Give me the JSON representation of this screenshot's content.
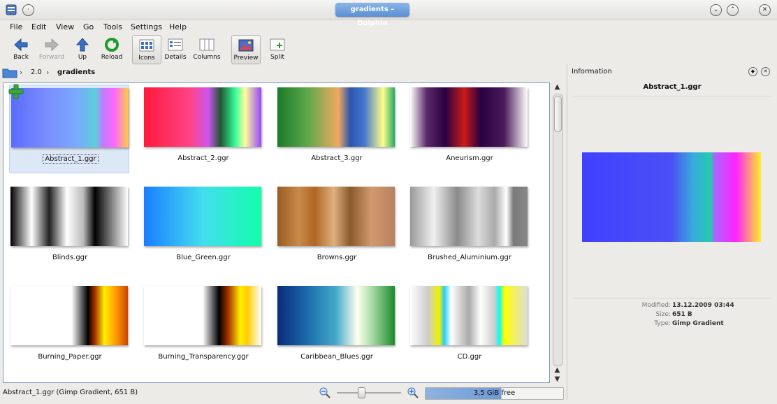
{
  "window": {
    "title": "gradients – Dolphin"
  },
  "menu": [
    "File",
    "Edit",
    "View",
    "Go",
    "Tools",
    "Settings",
    "Help"
  ],
  "toolbar": {
    "back": "Back",
    "forward": "Forward",
    "up": "Up",
    "reload": "Reload",
    "icons": "Icons",
    "details": "Details",
    "columns": "Columns",
    "preview": "Preview",
    "split": "Split"
  },
  "breadcrumb": {
    "parent": "2.0",
    "current": "gradients"
  },
  "files": [
    {
      "name": "Abstract_1.ggr",
      "gradient": "linear-gradient(90deg,#5a6cff 0%,#7a8cff 30%,#7aa8ff 55%,#5ccfd9 72%,#c07cff 78%,#ff66ff 88%,#ffd044 100%)"
    },
    {
      "name": "Abstract_2.ggr",
      "gradient": "linear-gradient(90deg,#ff1a3a 0%,#ff4488 40%,#cc55ee 55%,#225533 65%,#33ff99 78%,#ffff99 86%,#9944ff 100%)"
    },
    {
      "name": "Abstract_3.ggr",
      "gradient": "linear-gradient(90deg,#1d7a2a 0%,#5ba84a 25%,#f0a860 52%,#2a55b0 62%,#4477cc 74%,#ffff88 90%,#22aa66 100%)"
    },
    {
      "name": "Aneurism.ggr",
      "gradient": "linear-gradient(90deg,#ffffff 0%,#5a2a6a 14%,#2a0040 30%,#cc1a1a 46%,#2a0040 60%,#4a1a5a 80%,#ffffff 100%)"
    },
    {
      "name": "Blinds.ggr",
      "gradient": "linear-gradient(90deg,#000 0%,#fff 18%,#222 33%,#ffffff 48%,#bbb 62%,#000 72%,#ffffff 100%)"
    },
    {
      "name": "Blue_Green.ggr",
      "gradient": "linear-gradient(90deg,#1a7dff 0%,#44ddee 50%,#11ffaa 100%)"
    },
    {
      "name": "Browns.ggr",
      "gradient": "linear-gradient(90deg,#9a5a22 0%,#c88a4a 18%,#b06622 32%,#e0b080 48%,#8a5a2a 62%,#d09a70 80%,#b88060 100%)"
    },
    {
      "name": "Brushed_Aluminium.ggr",
      "gradient": "linear-gradient(90deg,#999 0%,#f0f0f0 20%,#8a8a8a 40%,#dcdcdc 58%,#aaa 72%,#ffffff 82%,#7a7a7a 88%,#888 100%)"
    },
    {
      "name": "Burning_Paper.ggr",
      "gradient": "linear-gradient(90deg,#ffffff 0%,#ffffff 52%,#000 66%,#aa3300 72%,#ffee00 80%,#ff9900 90%,#cc4400 100%)"
    },
    {
      "name": "Burning_Transparency.ggr",
      "gradient": "linear-gradient(90deg,#ffffff 0%,#ffffff 50%,#000 64%,#aa3300 72%,#ffee00 82%,#ffcc00 88%,#ffffff 100%)"
    },
    {
      "name": "Caribbean_Blues.ggr",
      "gradient": "linear-gradient(90deg,#0a2a7a 0%,#1a6aaa 25%,#44aacc 50%,#ffffee 68%,#aaddaa 80%,#1a8a2a 100%)"
    },
    {
      "name": "CD.ggr",
      "gradient": "linear-gradient(90deg,#ffffff 0%,#cccccc 15%,#f0f000 25%,#22ccff 29%,#ffffff 35%,#aaaaaa 50%,#ffffff 60%,#cccccc 72%,#00ffff 76%,#ffff00 80%,#dddddd 100%)"
    }
  ],
  "selected_index": 0,
  "info_panel": {
    "title": "Information",
    "filename": "Abstract_1.ggr",
    "preview_gradient": "linear-gradient(90deg,#4040ff 0%,#4a50f5 50%,#3aaadd 62%,#22ccaa 72%,#aa66ff 74%,#ff22ff 86%,#ffee22 100%)",
    "meta": [
      {
        "label": "Modified:",
        "value": "13.12.2009 03:44"
      },
      {
        "label": "Size:",
        "value": "651 B"
      },
      {
        "label": "Type:",
        "value": "Gimp Gradient"
      }
    ]
  },
  "status": {
    "text": "Abstract_1.ggr (Gimp Gradient, 651 B)",
    "free_space": "3,5 GiB free",
    "free_fraction": 0.55
  }
}
